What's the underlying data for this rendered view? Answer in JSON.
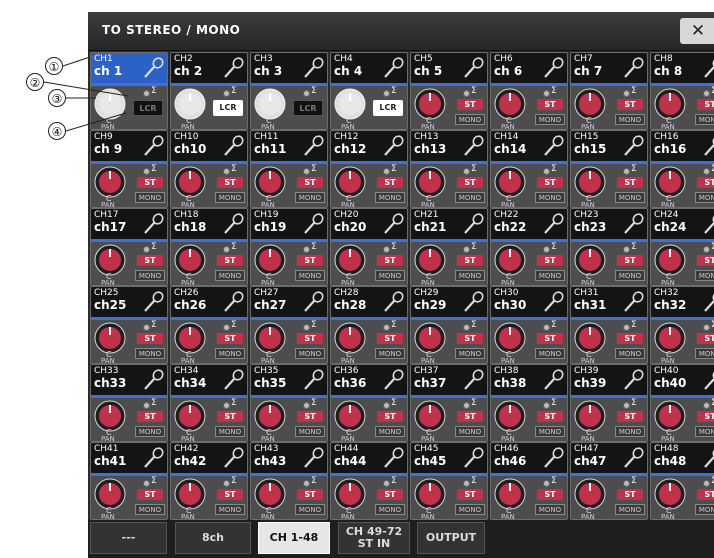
{
  "window": {
    "title": "TO STEREO / MONO",
    "close_label": "✕"
  },
  "callouts": [
    "①",
    "②",
    "③",
    "④"
  ],
  "labels": {
    "pan_center": "C",
    "pan": "PAN",
    "sigma": "Σ",
    "st": "ST",
    "mono": "MONO",
    "lcr": "LCR"
  },
  "channels": [
    {
      "num": "CH1",
      "name": "ch 1",
      "mode": "lcr",
      "lcr_on": false,
      "selected": true
    },
    {
      "num": "CH2",
      "name": "ch 2",
      "mode": "lcr",
      "lcr_on": true
    },
    {
      "num": "CH3",
      "name": "ch 3",
      "mode": "lcr",
      "lcr_on": false
    },
    {
      "num": "CH4",
      "name": "ch 4",
      "mode": "lcr",
      "lcr_on": true
    },
    {
      "num": "CH5",
      "name": "ch 5",
      "mode": "st"
    },
    {
      "num": "CH6",
      "name": "ch 6",
      "mode": "st"
    },
    {
      "num": "CH7",
      "name": "ch 7",
      "mode": "st"
    },
    {
      "num": "CH8",
      "name": "ch 8",
      "mode": "st"
    },
    {
      "num": "CH9",
      "name": "ch 9",
      "mode": "st"
    },
    {
      "num": "CH10",
      "name": "ch10",
      "mode": "st"
    },
    {
      "num": "CH11",
      "name": "ch11",
      "mode": "st"
    },
    {
      "num": "CH12",
      "name": "ch12",
      "mode": "st"
    },
    {
      "num": "CH13",
      "name": "ch13",
      "mode": "st"
    },
    {
      "num": "CH14",
      "name": "ch14",
      "mode": "st"
    },
    {
      "num": "CH15",
      "name": "ch15",
      "mode": "st"
    },
    {
      "num": "CH16",
      "name": "ch16",
      "mode": "st"
    },
    {
      "num": "CH17",
      "name": "ch17",
      "mode": "st"
    },
    {
      "num": "CH18",
      "name": "ch18",
      "mode": "st"
    },
    {
      "num": "CH19",
      "name": "ch19",
      "mode": "st"
    },
    {
      "num": "CH20",
      "name": "ch20",
      "mode": "st"
    },
    {
      "num": "CH21",
      "name": "ch21",
      "mode": "st"
    },
    {
      "num": "CH22",
      "name": "ch22",
      "mode": "st"
    },
    {
      "num": "CH23",
      "name": "ch23",
      "mode": "st"
    },
    {
      "num": "CH24",
      "name": "ch24",
      "mode": "st"
    },
    {
      "num": "CH25",
      "name": "ch25",
      "mode": "st"
    },
    {
      "num": "CH26",
      "name": "ch26",
      "mode": "st"
    },
    {
      "num": "CH27",
      "name": "ch27",
      "mode": "st"
    },
    {
      "num": "CH28",
      "name": "ch28",
      "mode": "st"
    },
    {
      "num": "CH29",
      "name": "ch29",
      "mode": "st"
    },
    {
      "num": "CH30",
      "name": "ch30",
      "mode": "st"
    },
    {
      "num": "CH31",
      "name": "ch31",
      "mode": "st"
    },
    {
      "num": "CH32",
      "name": "ch32",
      "mode": "st"
    },
    {
      "num": "CH33",
      "name": "ch33",
      "mode": "st"
    },
    {
      "num": "CH34",
      "name": "ch34",
      "mode": "st"
    },
    {
      "num": "CH35",
      "name": "ch35",
      "mode": "st"
    },
    {
      "num": "CH36",
      "name": "ch36",
      "mode": "st"
    },
    {
      "num": "CH37",
      "name": "ch37",
      "mode": "st"
    },
    {
      "num": "CH38",
      "name": "ch38",
      "mode": "st"
    },
    {
      "num": "CH39",
      "name": "ch39",
      "mode": "st"
    },
    {
      "num": "CH40",
      "name": "ch40",
      "mode": "st"
    },
    {
      "num": "CH41",
      "name": "ch41",
      "mode": "st"
    },
    {
      "num": "CH42",
      "name": "ch42",
      "mode": "st"
    },
    {
      "num": "CH43",
      "name": "ch43",
      "mode": "st"
    },
    {
      "num": "CH44",
      "name": "ch44",
      "mode": "st"
    },
    {
      "num": "CH45",
      "name": "ch45",
      "mode": "st"
    },
    {
      "num": "CH46",
      "name": "ch46",
      "mode": "st"
    },
    {
      "num": "CH47",
      "name": "ch47",
      "mode": "st"
    },
    {
      "num": "CH48",
      "name": "ch48",
      "mode": "st"
    }
  ],
  "tabs": [
    {
      "label": "---",
      "active": false
    },
    {
      "label": "8ch",
      "active": false
    },
    {
      "label": "CH 1-48",
      "active": true
    },
    {
      "label": "CH 49-72\nST IN",
      "active": false
    },
    {
      "label": "OUTPUT",
      "active": false
    }
  ],
  "colors": {
    "knob_lcr": "#e8e8e8",
    "knob_st": "#c0324a",
    "selected_head": "#2c62c6",
    "accent_bar": "#3f6fd8"
  },
  "icons": {
    "channel_icon": "mic-icon",
    "close": "close-icon"
  }
}
